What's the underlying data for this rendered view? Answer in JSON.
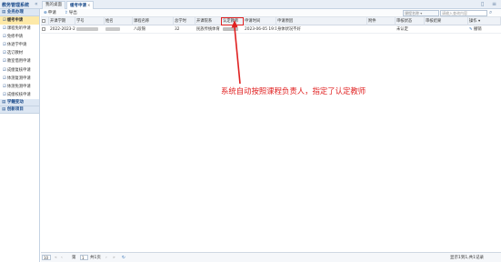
{
  "app": {
    "title": "教务管理系统"
  },
  "tabs": [
    {
      "label": "我的桌面",
      "close": ""
    },
    {
      "label": "缓考申请",
      "close": "×"
    }
  ],
  "sidebar": {
    "sections": [
      {
        "label": "业务办理"
      },
      {
        "label": "学籍变动"
      },
      {
        "label": "创新项目"
      }
    ],
    "items": [
      {
        "label": "缓考申请"
      },
      {
        "label": "课程免听申请"
      },
      {
        "label": "免修申请"
      },
      {
        "label": "休退学申请"
      },
      {
        "label": "选订教材"
      },
      {
        "label": "教室借用申请"
      },
      {
        "label": "成绩复核申请"
      },
      {
        "label": "体测复测申请"
      },
      {
        "label": "体测免测申请"
      },
      {
        "label": "成绩校核申请"
      }
    ]
  },
  "toolbar": {
    "apply": "申请",
    "export": "导出"
  },
  "search": {
    "select": "课程名称",
    "placeholder": "请输入查询内容"
  },
  "grid": {
    "headers": [
      "开课学期",
      "学号",
      "姓名",
      "课程名称",
      "总学时",
      "开课院系",
      "认定教师",
      "申请时间",
      "申请原因",
      "附件",
      "审核状态",
      "审核结果",
      "操作"
    ],
    "rows": [
      {
        "term": "2022-2023-2",
        "course": "八段锦",
        "hours": "32",
        "dept": "民族传统体育",
        "time": "2023-06-05 19:13:01",
        "reason": "身体状况不好",
        "status": "未认定",
        "action": "撤销"
      }
    ]
  },
  "annotation": "系统自动按照课程负责人，指定了认定教师",
  "pager": {
    "size": "10",
    "page_label_pre": "第",
    "page_value": "1",
    "page_label_post": "共1页",
    "summary": "显示1到1,共1记录"
  },
  "colors": {
    "accent": "#1d4d8c",
    "annotation": "#e02020",
    "active": "#fde9a8"
  }
}
